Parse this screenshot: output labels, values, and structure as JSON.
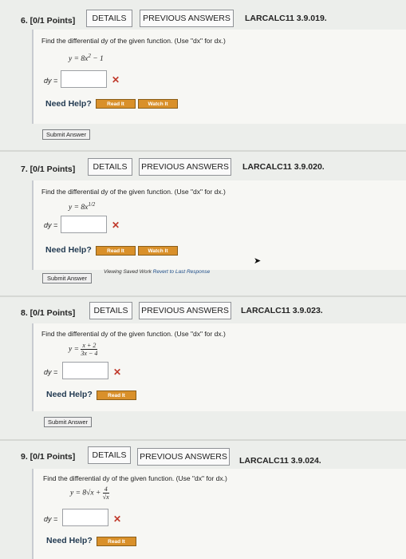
{
  "problems": [
    {
      "header": "6.  [0/1 Points]",
      "details": "DETAILS",
      "previous": "PREVIOUS ANSWERS",
      "code": "LARCALC11 3.9.019.",
      "question": "Find the differential dy of the given function. (Use \"dx\" for dx.)",
      "equation_lhs": "y = 8x",
      "equation_exp": "2",
      "equation_rhs": " − 1",
      "dy_label": "dy =",
      "wrong": "✕",
      "help": "Need Help?",
      "read": "Read It",
      "watch": "Watch It",
      "submit": "Submit Answer"
    },
    {
      "header": "7.  [0/1 Points]",
      "details": "DETAILS",
      "previous": "PREVIOUS ANSWERS",
      "code": "LARCALC11 3.9.020.",
      "question": "Find the differential dy of the given function. (Use \"dx\" for dx.)",
      "equation_lhs": "y = 8x",
      "equation_exp": "1/2",
      "dy_label": "dy =",
      "wrong": "✕",
      "help": "Need Help?",
      "read": "Read It",
      "watch": "Watch It",
      "submit": "Submit Answer",
      "saved_text": "Viewing Saved Work",
      "revert_link": "Revert to Last Response"
    },
    {
      "header": "8.  [0/1 Points]",
      "details": "DETAILS",
      "previous": "PREVIOUS ANSWERS",
      "code": "LARCALC11 3.9.023.",
      "question": "Find the differential dy of the given function. (Use \"dx\" for dx.)",
      "equation_lhs": "y =",
      "frac_num": "x + 2",
      "frac_den": "3x − 4",
      "dy_label": "dy =",
      "wrong": "✕",
      "help": "Need Help?",
      "read": "Read It",
      "submit": "Submit Answer"
    },
    {
      "header": "9.  [0/1 Points]",
      "details": "DETAILS",
      "previous": "PREVIOUS ANSWERS",
      "code": "LARCALC11 3.9.024.",
      "question": "Find the differential dy of the given function. (Use \"dx\" for dx.)",
      "equation_lhs": "y = 8√x +",
      "frac_num": "4",
      "frac_den": "√x",
      "dy_label": "dy =",
      "wrong": "✕",
      "help": "Need Help?",
      "read": "Read It"
    }
  ],
  "colors": {
    "wrong": "#c0392b",
    "read_button": "#d9902a",
    "link": "#1f4e8a"
  }
}
